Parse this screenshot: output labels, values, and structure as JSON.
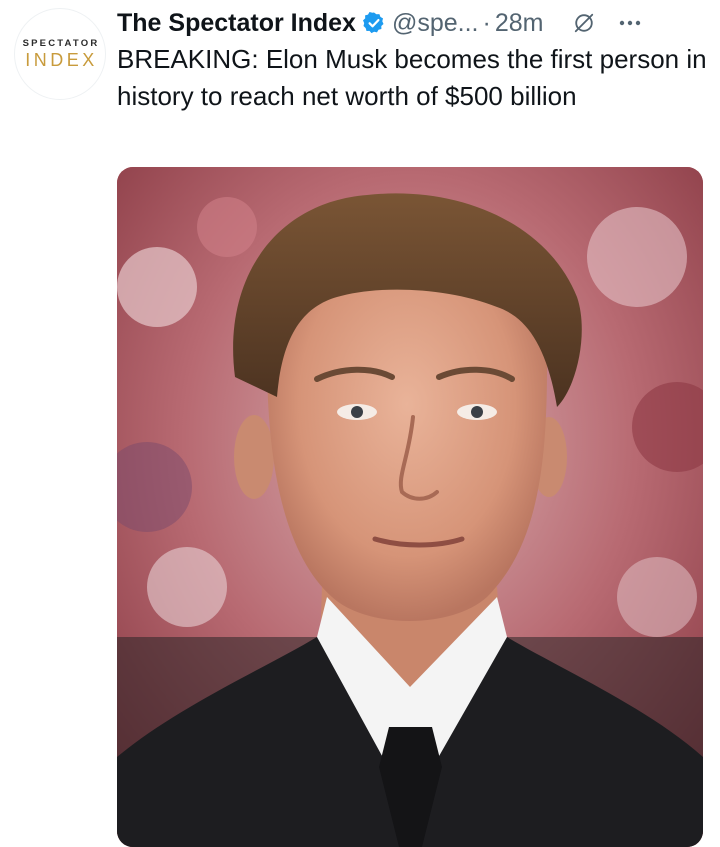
{
  "tweet": {
    "author_name": "The Spectator Index",
    "handle": "@spe...",
    "separator": "·",
    "timestamp": "28m",
    "text": "BREAKING: Elon Musk becomes the first person in history to reach net worth of $500 billion",
    "verified_badge_color": "#1d9bf0",
    "icons": [
      "verified-badge-icon",
      "grok-icon",
      "more-options-icon"
    ]
  },
  "avatar": {
    "top_text": "SPECTATOR",
    "bottom_text": "INDEX",
    "accent_color": "#c89b3c"
  },
  "media": {
    "kind": "photo"
  }
}
